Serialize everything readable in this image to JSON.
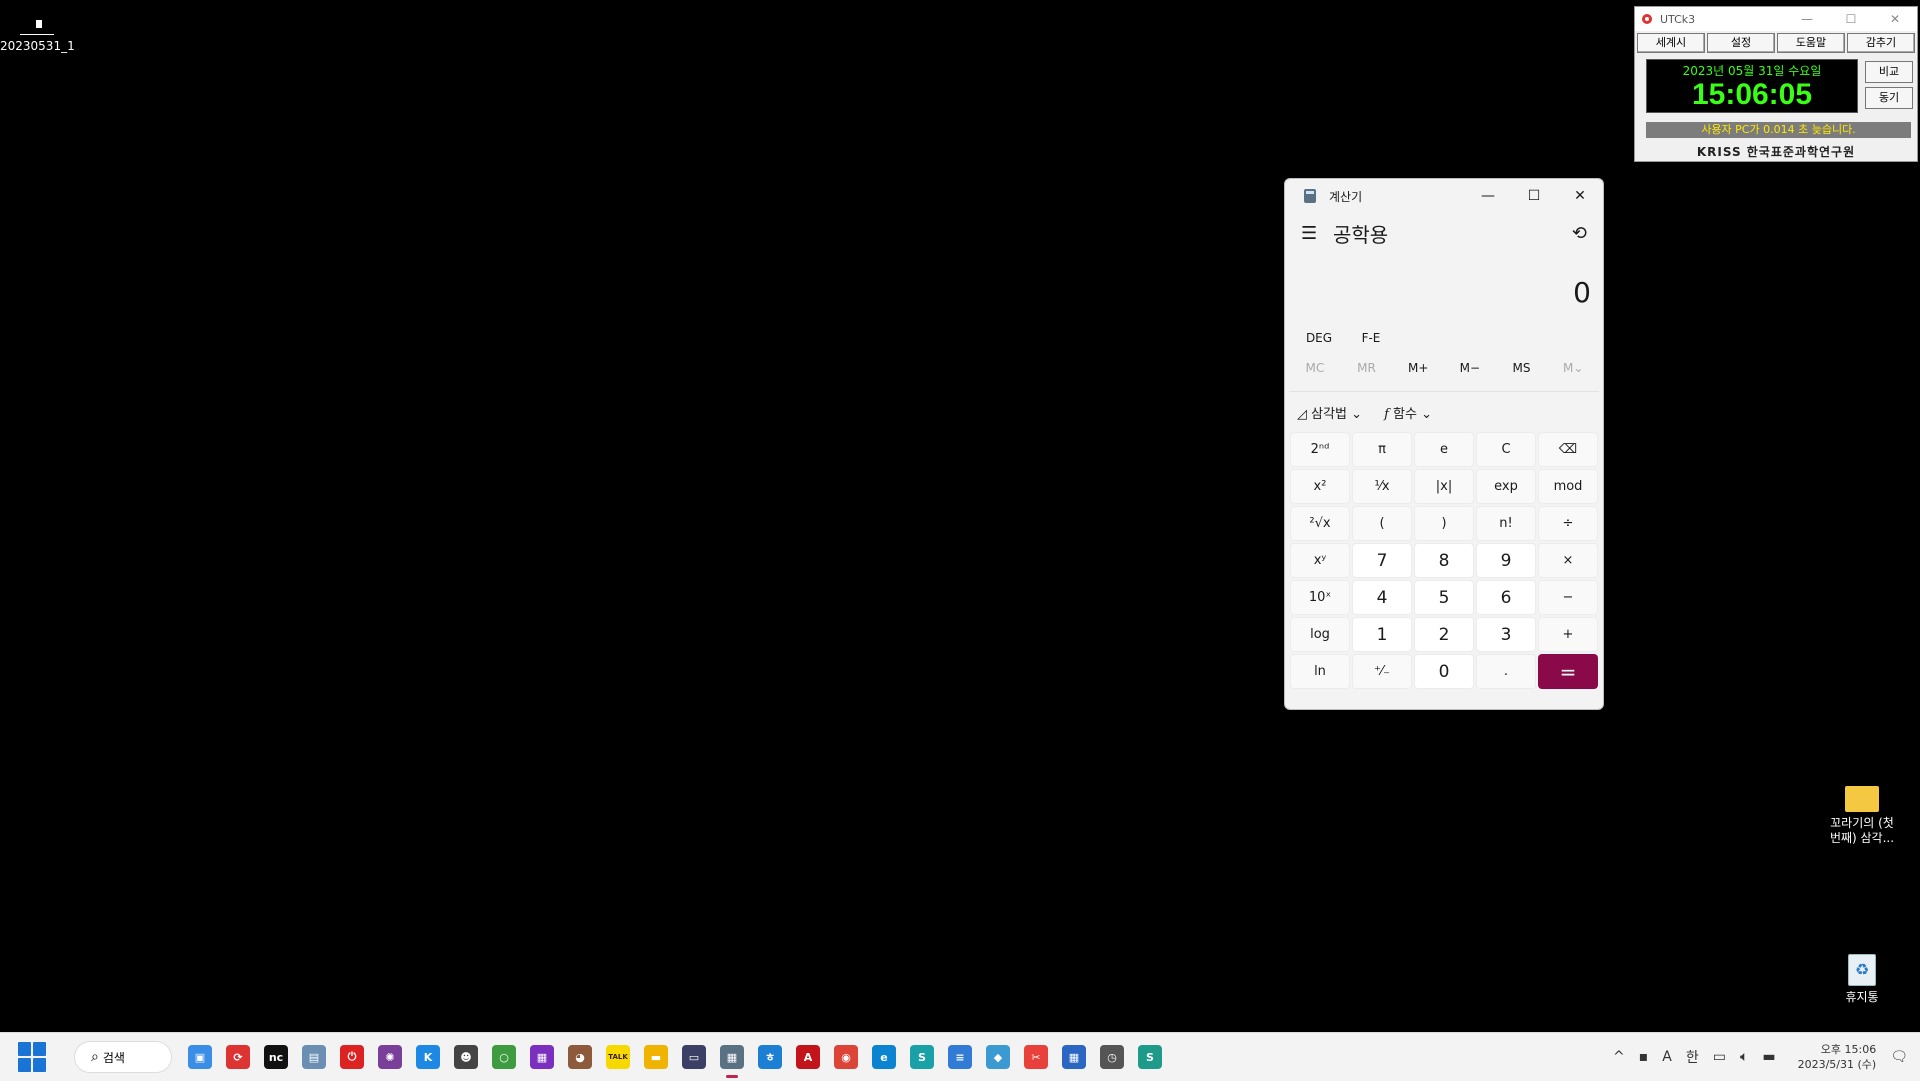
{
  "desktop": {
    "top_left_icon": {
      "label": "20230531_1"
    },
    "folder_shortcut": {
      "label": "꼬라기의 (첫\n번째) 삼각..."
    },
    "recycle_bin": {
      "label": "휴지통"
    }
  },
  "utc": {
    "title": "UTCk3",
    "menu": [
      "세계시",
      "설정",
      "도움말",
      "감추기"
    ],
    "date": "2023년 05월 31일 수요일",
    "time": "15:06:05",
    "compare_label": "비교",
    "sync_label": "동기",
    "status": "사용자 PC가 0.014 초 늦습니다.",
    "logo": "KRISS 한국표준과학연구원",
    "colors": {
      "clock_text": "#39ff14",
      "status_text": "#ffea00"
    }
  },
  "calculator": {
    "title": "계산기",
    "mode": "공학용",
    "display": "0",
    "angle_unit": "DEG",
    "fe_label": "F-E",
    "memory": [
      "MC",
      "MR",
      "M+",
      "M−",
      "MS",
      "M⌄"
    ],
    "trig_label": "삼각법",
    "func_label": "함수",
    "keys": [
      "2ⁿᵈ",
      "π",
      "e",
      "C",
      "⌫",
      "x²",
      "¹⁄x",
      "|x|",
      "exp",
      "mod",
      "²√x",
      "(",
      ")",
      "n!",
      "÷",
      "xʸ",
      "7",
      "8",
      "9",
      "×",
      "10ˣ",
      "4",
      "5",
      "6",
      "−",
      "log",
      "1",
      "2",
      "3",
      "+",
      "ln",
      "⁺⁄₋",
      "0",
      ".",
      "="
    ],
    "accent_color": "#8a0a49"
  },
  "taskbar": {
    "search_label": "검색",
    "apps": [
      {
        "name": "photos-icon",
        "glyph": "▣",
        "color": "#3a8ee6"
      },
      {
        "name": "sync-icon",
        "glyph": "⟳",
        "color": "#d33"
      },
      {
        "name": "nc-icon",
        "glyph": "nc",
        "color": "#111"
      },
      {
        "name": "monitor-icon",
        "glyph": "▤",
        "color": "#6a8fb3"
      },
      {
        "name": "power-icon",
        "glyph": "⏻",
        "color": "#d22"
      },
      {
        "name": "atom-icon",
        "glyph": "✺",
        "color": "#7a3f98"
      },
      {
        "name": "k-icon",
        "glyph": "K",
        "color": "#1e88e5"
      },
      {
        "name": "alien-icon",
        "glyph": "☻",
        "color": "#444"
      },
      {
        "name": "bottle-icon",
        "glyph": "○",
        "color": "#3f9b3f"
      },
      {
        "name": "mbc-icon",
        "glyph": "▦",
        "color": "#7b2fbe"
      },
      {
        "name": "monkey-icon",
        "glyph": "◕",
        "color": "#8d5a3b"
      },
      {
        "name": "kakaotalk-icon",
        "glyph": "TALK",
        "color": "#f7d900"
      },
      {
        "name": "folder-icon",
        "glyph": "▬",
        "color": "#f0b400"
      },
      {
        "name": "terminal-icon",
        "glyph": "▭",
        "color": "#3b3f66"
      },
      {
        "name": "calculator-icon",
        "glyph": "▦",
        "color": "#5a7184"
      },
      {
        "name": "hangul-icon",
        "glyph": "ㅎ",
        "color": "#1d7fd3"
      },
      {
        "name": "acrobat-icon",
        "glyph": "A",
        "color": "#c4141b"
      },
      {
        "name": "chrome-icon",
        "glyph": "◉",
        "color": "#db4437"
      },
      {
        "name": "edge-icon",
        "glyph": "e",
        "color": "#0a84d0"
      },
      {
        "name": "app-s-icon",
        "glyph": "S",
        "color": "#1aa1a8"
      },
      {
        "name": "notepad-icon",
        "glyph": "≡",
        "color": "#2f7bd6"
      },
      {
        "name": "paint-icon",
        "glyph": "◆",
        "color": "#3c9ad3"
      },
      {
        "name": "capture-icon",
        "glyph": "✂",
        "color": "#e8413b"
      },
      {
        "name": "calendar-icon",
        "glyph": "▦",
        "color": "#2b67c2"
      },
      {
        "name": "clock-icon",
        "glyph": "◷",
        "color": "#555"
      },
      {
        "name": "app-s2-icon",
        "glyph": "S",
        "color": "#1d9a8a"
      }
    ],
    "tray": {
      "chevron": "^",
      "ime_a": "A",
      "ime_han": "한",
      "time": "오후 15:06",
      "date": "2023/5/31 (수)"
    }
  }
}
